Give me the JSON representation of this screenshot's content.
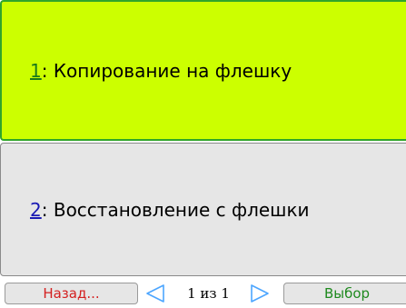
{
  "menu": {
    "items": [
      {
        "number": "1",
        "separator": ":",
        "label": " Копирование на флешку",
        "selected": true
      },
      {
        "number": "2",
        "separator": ":",
        "label": " Восстановление с флешки",
        "selected": false
      }
    ]
  },
  "bottom_bar": {
    "back_label": "Назад...",
    "prev_icon": "left-triangle-icon",
    "page_indicator": "1 из 1",
    "next_icon": "right-triangle-icon",
    "select_label": "Выбор"
  },
  "colors": {
    "selected_bg": "#ccff00",
    "selected_border": "#2fa52a",
    "item_bg": "#e6e6e6",
    "back_text": "#d42020",
    "select_text": "#1f8a1f",
    "arrow": "#4da6ff"
  }
}
